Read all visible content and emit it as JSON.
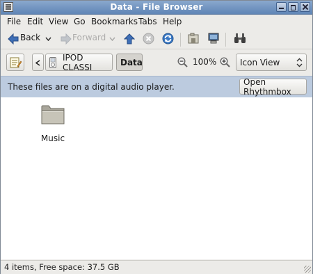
{
  "window": {
    "title": "Data - File Browser"
  },
  "menubar": {
    "items": [
      "File",
      "Edit",
      "View",
      "Go",
      "Bookmarks",
      "Tabs",
      "Help"
    ]
  },
  "toolbar": {
    "back_label": "Back",
    "forward_label": "Forward"
  },
  "location": {
    "device_label": "IPOD CLASSI",
    "current_label": "Data",
    "zoom": "100%",
    "view_mode": "Icon View"
  },
  "infobar": {
    "message": "These files are on a digital audio player.",
    "button_label": "Open Rhythmbox"
  },
  "files": [
    {
      "name": "Music",
      "icon": "folder-icon"
    }
  ],
  "status": {
    "text": "4 items, Free space: 37.5 GB"
  }
}
